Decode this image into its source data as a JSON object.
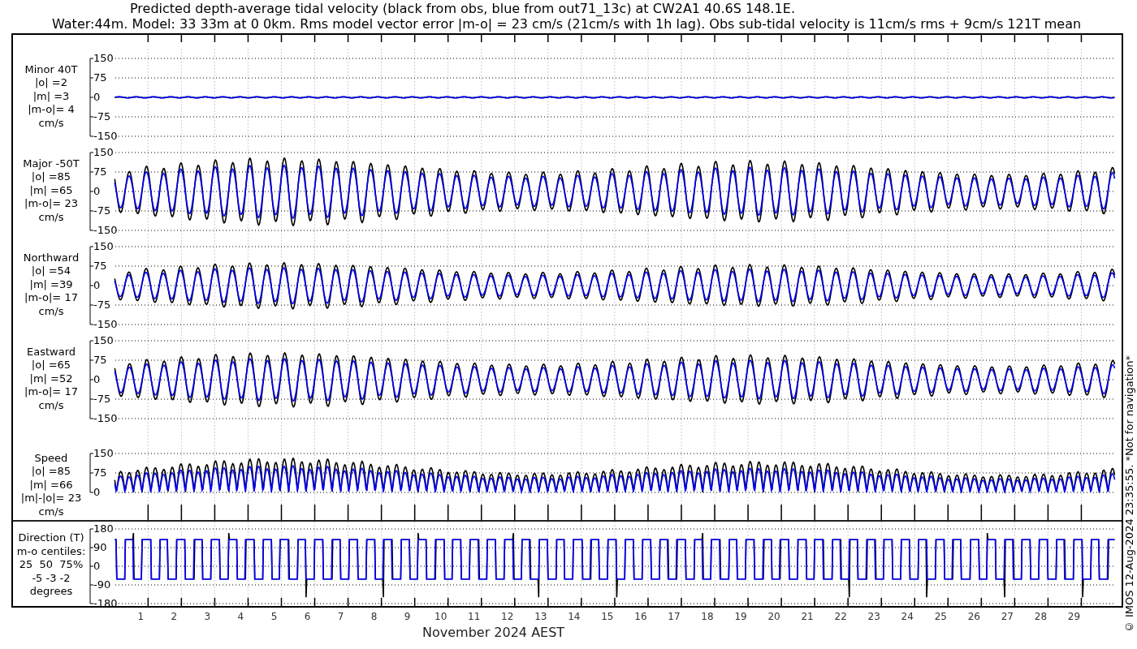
{
  "title": [
    "Predicted depth-average tidal velocity (black from obs, blue from out71_13c) at CW2A1 40.6S 148.1E.",
    "Water:44m. Model: 33 33m at 0 0km. Rms model vector error |m-o| = 23 cm/s (21cm/s with 1h lag). Obs sub-tidal velocity is 11cm/s rms + 9cm/s 121T mean"
  ],
  "panels": [
    {
      "kind": "minor",
      "label": [
        "Minor 40T",
        "|o| =2",
        "|m| =3",
        "|m-o|= 4",
        "cm/s"
      ],
      "yticks": [
        "150",
        "75",
        "0",
        "-75",
        "-150"
      ]
    },
    {
      "kind": "major",
      "label": [
        "Major -50T",
        "|o| =85",
        "|m| =65",
        "|m-o|= 23",
        "cm/s"
      ],
      "yticks": [
        "150",
        "75",
        "0",
        "-75",
        "-150"
      ]
    },
    {
      "kind": "northward",
      "label": [
        "Northward",
        "|o| =54",
        "|m| =39",
        "|m-o|= 17",
        "cm/s"
      ],
      "yticks": [
        "150",
        "75",
        "0",
        "-75",
        "-150"
      ]
    },
    {
      "kind": "eastward",
      "label": [
        "Eastward",
        "|o| =65",
        "|m| =52",
        "|m-o|= 17",
        "cm/s"
      ],
      "yticks": [
        "150",
        "75",
        "0",
        "-75",
        "-150"
      ]
    },
    {
      "kind": "speed",
      "label": [
        "Speed",
        "|o| =85",
        "|m| =66",
        "|m|-|o|= 23",
        "cm/s"
      ],
      "yticks": [
        "150",
        "75",
        "0"
      ]
    },
    {
      "kind": "direction",
      "label": [
        "Direction (T)",
        "m-o centiles:",
        "25  50  75%",
        "-5 -3 -2",
        "degrees"
      ],
      "yticks": [
        "180",
        "90",
        "0",
        "-90",
        "-180"
      ]
    }
  ],
  "xaxis": {
    "day_labels": [
      "1",
      "2",
      "3",
      "4",
      "5",
      "6",
      "7",
      "8",
      "9",
      "10",
      "11",
      "12",
      "13",
      "14",
      "15",
      "16",
      "17",
      "18",
      "19",
      "20",
      "21",
      "22",
      "23",
      "24",
      "25",
      "26",
      "27",
      "28",
      "29"
    ],
    "label": "November 2024 AEST"
  },
  "credit": "© IMOS 12-Aug-2024 23:35:55. *Not for navigation*"
}
